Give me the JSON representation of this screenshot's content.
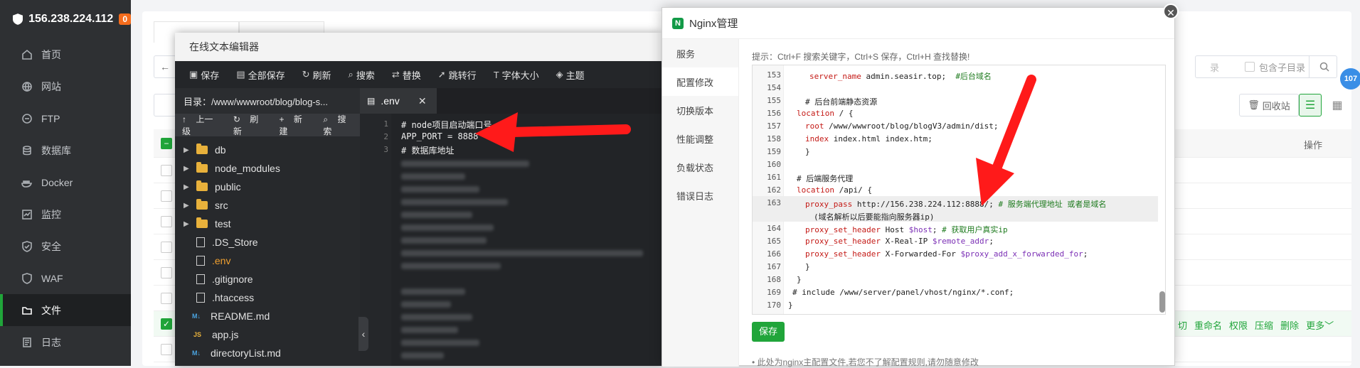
{
  "sidebar": {
    "server_ip": "156.238.224.112",
    "alert_count": "0",
    "items": [
      {
        "label": "首页",
        "icon": "home-icon"
      },
      {
        "label": "网站",
        "icon": "globe-icon"
      },
      {
        "label": "FTP",
        "icon": "ftp-icon"
      },
      {
        "label": "数据库",
        "icon": "database-icon"
      },
      {
        "label": "Docker",
        "icon": "docker-icon"
      },
      {
        "label": "监控",
        "icon": "monitor-icon"
      },
      {
        "label": "安全",
        "icon": "shield-icon"
      },
      {
        "label": "WAF",
        "icon": "firewall-icon"
      },
      {
        "label": "文件",
        "icon": "folder-icon"
      },
      {
        "label": "日志",
        "icon": "log-icon"
      }
    ],
    "active_item": "文件"
  },
  "file_manager": {
    "search_placeholder": "录",
    "include_subdir_label": "包含子目录",
    "recycle_label": "回收站",
    "ops_header": "操作",
    "row_actions": [
      "切",
      "重命名",
      "权限",
      "压缩",
      "删除",
      "更多"
    ]
  },
  "editor": {
    "title": "在线文本编辑器",
    "toolbar": [
      {
        "label": "保存",
        "icon": "save-icon"
      },
      {
        "label": "全部保存",
        "icon": "save-all-icon"
      },
      {
        "label": "刷新",
        "icon": "refresh-icon"
      },
      {
        "label": "搜索",
        "icon": "search-icon"
      },
      {
        "label": "替换",
        "icon": "replace-icon"
      },
      {
        "label": "跳转行",
        "icon": "goto-line-icon"
      },
      {
        "label": "字体大小",
        "icon": "font-size-icon"
      },
      {
        "label": "主题",
        "icon": "theme-icon"
      }
    ],
    "directory": "目录：/www/wwwroot/blog/blog-s...",
    "tab_name": ".env",
    "tree_actions": [
      "上一级",
      "刷新",
      "新建",
      "搜索"
    ],
    "tree": [
      {
        "name": "db",
        "type": "folder"
      },
      {
        "name": "node_modules",
        "type": "folder"
      },
      {
        "name": "public",
        "type": "folder"
      },
      {
        "name": "src",
        "type": "folder"
      },
      {
        "name": "test",
        "type": "folder"
      },
      {
        "name": ".DS_Store",
        "type": "file"
      },
      {
        "name": ".env",
        "type": "file"
      },
      {
        "name": ".gitignore",
        "type": "file"
      },
      {
        "name": ".htaccess",
        "type": "file"
      },
      {
        "name": "README.md",
        "type": "md"
      },
      {
        "name": "app.js",
        "type": "js"
      },
      {
        "name": "directoryList.md",
        "type": "md"
      }
    ],
    "code_lines": [
      {
        "n": "1",
        "text": "# node项目启动端口号"
      },
      {
        "n": "2",
        "text": "APP_PORT = 8888"
      },
      {
        "n": "3",
        "text": "# 数据库地址"
      }
    ]
  },
  "nginx": {
    "title": "Nginx管理",
    "menu": [
      "服务",
      "配置修改",
      "切换版本",
      "性能调整",
      "负载状态",
      "错误日志"
    ],
    "active_menu": "配置修改",
    "tip": "提示：Ctrl+F 搜索关键字，Ctrl+S 保存，Ctrl+H 查找替换!",
    "lines": [
      {
        "n": "153",
        "text": "server_name admin.seasir.top;  #后台域名"
      },
      {
        "n": "154",
        "text": ""
      },
      {
        "n": "155",
        "text": "# 后台前端静态资源"
      },
      {
        "n": "156",
        "text": "location / {"
      },
      {
        "n": "157",
        "text": "root /www/wwwroot/blog/blogV3/admin/dist;"
      },
      {
        "n": "158",
        "text": "index index.html index.htm;"
      },
      {
        "n": "159",
        "text": "}"
      },
      {
        "n": "160",
        "text": ""
      },
      {
        "n": "161",
        "text": "# 后端服务代理"
      },
      {
        "n": "162",
        "text": "location /api/ {"
      },
      {
        "n": "163",
        "text": "proxy_pass http://156.238.224.112:8888/; # 服务端代理地址 或者是域名"
      },
      {
        "n": "",
        "text": "(域名解析以后要能指向服务器ip)"
      },
      {
        "n": "164",
        "text": "proxy_set_header Host $host; # 获取用户真实ip"
      },
      {
        "n": "165",
        "text": "proxy_set_header X-Real-IP $remote_addr;"
      },
      {
        "n": "166",
        "text": "proxy_set_header X-Forwarded-For $proxy_add_x_forwarded_for;"
      },
      {
        "n": "167",
        "text": "}"
      },
      {
        "n": "168",
        "text": "}"
      },
      {
        "n": "169",
        "text": "# include /www/server/panel/vhost/nginx/*.conf;"
      },
      {
        "n": "170",
        "text": "}"
      }
    ],
    "save_label": "保存",
    "note": "此处为nginx主配置文件,若您不了解配置规则,请勿随意修改"
  },
  "badge_107": "107"
}
